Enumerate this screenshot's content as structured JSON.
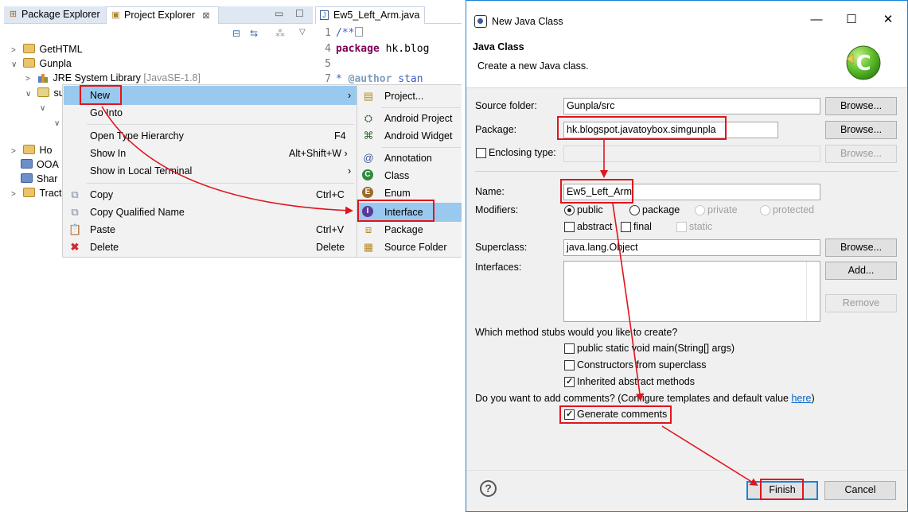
{
  "explorer": {
    "tabs": [
      {
        "label": "Package Explorer"
      },
      {
        "label": "Project Explorer",
        "close": "⊠"
      }
    ],
    "tree": {
      "gethtml": "GetHTML",
      "gunpla": "Gunpla",
      "jre": "JRE System Library",
      "jre_version": "[JavaSE-1.8]",
      "src_short": "su",
      "ho": "Ho",
      "ooa": "OOA",
      "shar": "Shar",
      "tract": "Tract"
    }
  },
  "editor": {
    "tab_label": "Ew5_Left_Arm.java",
    "lines": [
      {
        "num": "1",
        "text": "/**"
      },
      {
        "num": "4",
        "keyword": "package",
        "text": " hk.blog"
      },
      {
        "num": "5",
        "text": ""
      },
      {
        "num": "7",
        "tag": "@author",
        "text": " stan"
      }
    ]
  },
  "context_menu": {
    "items": [
      {
        "label": "New",
        "arrow": "›"
      },
      {
        "label": "Go Into"
      },
      {
        "label": "Open Type Hierarchy",
        "shortcut": "F4"
      },
      {
        "label": "Show In",
        "shortcut": "Alt+Shift+W ›"
      },
      {
        "label": "Show in Local Terminal",
        "arrow": "›"
      },
      {
        "label": "Copy",
        "shortcut": "Ctrl+C"
      },
      {
        "label": "Copy Qualified Name"
      },
      {
        "label": "Paste",
        "shortcut": "Ctrl+V"
      },
      {
        "label": "Delete",
        "shortcut": "Delete"
      }
    ],
    "submenu": [
      {
        "label": "Project..."
      },
      {
        "label": "Android Project"
      },
      {
        "label": "Android Widget"
      },
      {
        "label": "Annotation"
      },
      {
        "label": "Class"
      },
      {
        "label": "Enum"
      },
      {
        "label": "Interface"
      },
      {
        "label": "Package"
      },
      {
        "label": "Source Folder"
      }
    ]
  },
  "dialog": {
    "title": "New Java Class",
    "banner_title": "Java Class",
    "banner_desc": "Create a new Java class.",
    "source_folder_label": "Source folder:",
    "source_folder_value": "Gunpla/src",
    "package_label": "Package:",
    "package_value": "hk.blogspot.javatoybox.simgunpla",
    "enclosing_label": "Enclosing type:",
    "name_label": "Name:",
    "name_value": "Ew5_Left_Arm",
    "modifiers_label": "Modifiers:",
    "mod_public": "public",
    "mod_package": "package",
    "mod_private": "private",
    "mod_protected": "protected",
    "mod_abstract": "abstract",
    "mod_final": "final",
    "mod_static": "static",
    "superclass_label": "Superclass:",
    "superclass_value": "java.lang.Object",
    "interfaces_label": "Interfaces:",
    "browse": "Browse...",
    "add": "Add...",
    "remove": "Remove",
    "stubs_question": "Which method stubs would you like to create?",
    "stub_main": "public static void main(String[] args)",
    "stub_ctor": "Constructors from superclass",
    "stub_inherited": "Inherited abstract methods",
    "comments_question": "Do you want to add comments? (Configure templates and default value ",
    "comments_link": "here",
    "comments_close": ")",
    "generate_comments": "Generate comments",
    "finish": "Finish",
    "cancel": "Cancel",
    "help": "?",
    "win_min": "—",
    "win_max": "☐",
    "win_close": "✕"
  },
  "colors": {
    "annotation_red": "#e0141e",
    "selection_blue": "#99c9ef",
    "dialog_border": "#1883d7"
  }
}
